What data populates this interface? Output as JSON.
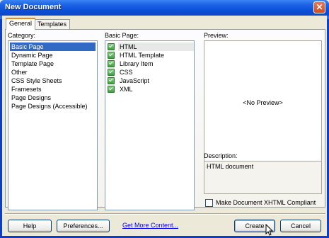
{
  "window": {
    "title": "New Document"
  },
  "tabs": [
    {
      "label": "General",
      "active": true
    },
    {
      "label": "Templates",
      "active": false
    }
  ],
  "category": {
    "label": "Category:",
    "items": [
      "Basic Page",
      "Dynamic Page",
      "Template Page",
      "Other",
      "CSS Style Sheets",
      "Framesets",
      "Page Designs",
      "Page Designs (Accessible)"
    ],
    "selected": "Basic Page"
  },
  "basic_page": {
    "label": "Basic Page:",
    "items": [
      "HTML",
      "HTML Template",
      "Library Item",
      "CSS",
      "JavaScript",
      "XML"
    ],
    "selected": "HTML",
    "item_icon": "page-icon"
  },
  "preview": {
    "label": "Preview:",
    "text": "<No Preview>"
  },
  "description": {
    "label": "Description:",
    "text": "HTML document"
  },
  "xhtml_checkbox": {
    "label": "Make Document XHTML Compliant",
    "checked": false
  },
  "buttons": {
    "help": "Help",
    "preferences": "Preferences...",
    "get_more": "Get More Content...",
    "create": "Create",
    "cancel": "Cancel"
  },
  "colors": {
    "titlebar": "#0a4ed8",
    "selection": "#316ac5",
    "dialog": "#ece9d8",
    "link": "#0000ee"
  }
}
